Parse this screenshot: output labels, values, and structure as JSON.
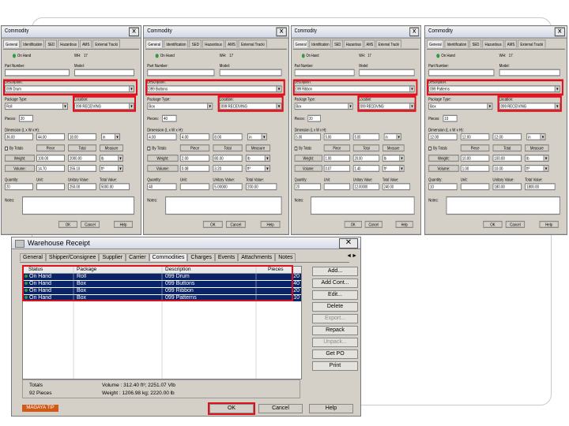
{
  "dialogs": [
    {
      "title": "Commodity",
      "tabs": [
        "General",
        "Identification",
        "SED",
        "Hazardous",
        "AMS",
        "External Tracki"
      ],
      "status": "On Hand",
      "wh_label": "WH:",
      "wh_value": "17",
      "part_label": "Part Number:",
      "model_label": "Model:",
      "desc_label": "Description:",
      "desc_value": "099 Drum",
      "pkg_label": "Package Type:",
      "pkg_value": "Roll",
      "loc_label": "Location:",
      "loc_value": "099 RECEIVING",
      "pieces_label": "Pieces:",
      "pieces_value": "20",
      "dim_label": "Dimension (L x W x H):",
      "dim_values": [
        "36.00",
        "44.00",
        "18.00",
        "in"
      ],
      "bytotals_label": "By Totals",
      "col_piece": "Piece",
      "col_total": "Total",
      "col_measure": "Measure",
      "weight_label": "Weight:",
      "weight_values": [
        "100.00",
        "2000.00",
        "lb"
      ],
      "volume_label": "Volume:",
      "volume_values": [
        "14.70",
        "255.10",
        "ft³"
      ],
      "qty_label": "Quantity:",
      "unit_label": "Unit:",
      "uv_label": "Unitary Value:",
      "tv_label": "Total Value:",
      "qty_value": "20",
      "unit_value": "",
      "uv_value": "250.00",
      "tv_value": "5000.00",
      "notes_label": "Notes:",
      "ok": "OK",
      "cancel": "Cancel",
      "help": "Help"
    },
    {
      "title": "Commodity",
      "tabs": [
        "General",
        "Identification",
        "SED",
        "Hazardous",
        "AMS",
        "External Tracki"
      ],
      "status": "On Hand",
      "wh_label": "WH:",
      "wh_value": "17",
      "part_label": "Part Number:",
      "model_label": "Model:",
      "desc_label": "Description:",
      "desc_value": "099 Buttons",
      "pkg_label": "Package Type:",
      "pkg_value": "Box",
      "loc_label": "Location:",
      "loc_value": "099 RECEIVING",
      "pieces_label": "Pieces:",
      "pieces_value": "40",
      "dim_label": "Dimension (L x W x H):",
      "dim_values": [
        "4.00",
        "4.00",
        "8.00",
        "in"
      ],
      "bytotals_label": "By Totals",
      "col_piece": "Piece",
      "col_total": "Total",
      "col_measure": "Measure",
      "weight_label": "Weight:",
      "weight_values": [
        "2.00",
        "80.00",
        "lb"
      ],
      "volume_label": "Volume:",
      "volume_values": [
        "0.08",
        "3.20",
        "ft³"
      ],
      "qty_label": "Quantity:",
      "unit_label": "Unit:",
      "uv_label": "Unitary Value:",
      "tv_label": "Total Value:",
      "qty_value": "40",
      "unit_value": "",
      "uv_value": "5.00000",
      "tv_value": "200.00",
      "notes_label": "Notes:",
      "ok": "OK",
      "cancel": "Cancel",
      "help": "Help"
    },
    {
      "title": "Commodity",
      "tabs": [
        "General",
        "Identification",
        "SED",
        "Hazardous",
        "AMS",
        "External Tracki"
      ],
      "status": "On Hand",
      "wh_label": "WH:",
      "wh_value": "17",
      "part_label": "Part Number:",
      "model_label": "Model:",
      "desc_label": "Description:",
      "desc_value": "099 Ribbon",
      "pkg_label": "Package Type:",
      "pkg_value": "Box",
      "loc_label": "Location:",
      "loc_value": "099 RECEIVING",
      "pieces_label": "Pieces:",
      "pieces_value": "20",
      "dim_label": "Dimension (L x W x H):",
      "dim_values": [
        "5.00",
        "5.00",
        "5.00",
        "in"
      ],
      "bytotals_label": "By Totals",
      "col_piece": "Piece",
      "col_total": "Total",
      "col_measure": "Measure",
      "weight_label": "Weight:",
      "weight_values": [
        "1.00",
        "20.00",
        "lb"
      ],
      "volume_label": "Volume:",
      "volume_values": [
        "0.07",
        "1.40",
        "ft³"
      ],
      "qty_label": "Quantity:",
      "unit_label": "Unit:",
      "uv_label": "Unitary Value:",
      "tv_label": "Total Value:",
      "qty_value": "20",
      "unit_value": "",
      "uv_value": "12.00000",
      "tv_value": "240.00",
      "notes_label": "Notes:",
      "ok": "OK",
      "cancel": "Cancel",
      "help": "Help"
    },
    {
      "title": "Commodity",
      "tabs": [
        "General",
        "Identification",
        "SED",
        "Hazardous",
        "AMS",
        "External Tracki"
      ],
      "status": "On Hand",
      "wh_label": "WH:",
      "wh_value": "17",
      "part_label": "Part Number:",
      "model_label": "Model:",
      "desc_label": "Description:",
      "desc_value": "099 Patterns",
      "pkg_label": "Package Type:",
      "pkg_value": "Box",
      "loc_label": "Location:",
      "loc_value": "099 RECEIVING",
      "pieces_label": "Pieces:",
      "pieces_value": "10",
      "dim_label": "Dimension (L x W x H):",
      "dim_values": [
        "12.00",
        "12.00",
        "12.00",
        "in"
      ],
      "bytotals_label": "By Totals",
      "col_piece": "Piece",
      "col_total": "Total",
      "col_measure": "Measure",
      "weight_label": "Weight:",
      "weight_values": [
        "10.00",
        "100.00",
        "lb"
      ],
      "volume_label": "Volume:",
      "volume_values": [
        "1.00",
        "10.00",
        "ft³"
      ],
      "qty_label": "Quantity:",
      "unit_label": "Unit:",
      "uv_label": "Unitary Value:",
      "tv_label": "Total Value:",
      "qty_value": "10",
      "unit_value": "",
      "uv_value": "180.00",
      "tv_value": "1800.00",
      "notes_label": "Notes:",
      "ok": "OK",
      "cancel": "Cancel",
      "help": "Help"
    }
  ],
  "receipt": {
    "title": "Warehouse Receipt",
    "tabs": [
      "General",
      "Shipper/Consignee",
      "Supplier",
      "Carrier",
      "Commodities",
      "Charges",
      "Events",
      "Attachments",
      "Notes"
    ],
    "columns": [
      "Status",
      "Package",
      "Description",
      "Pieces"
    ],
    "rows": [
      {
        "status": "On Hand",
        "package": "Roll",
        "description": "099 Drum",
        "pieces": "20"
      },
      {
        "status": "On Hand",
        "package": "Box",
        "description": "099 Buttons",
        "pieces": "40"
      },
      {
        "status": "On Hand",
        "package": "Box",
        "description": "099 Ribbon",
        "pieces": "20"
      },
      {
        "status": "On Hand",
        "package": "Box",
        "description": "099 Patterns",
        "pieces": "10"
      }
    ],
    "side_buttons": {
      "add": "Add...",
      "add_cont": "Add Cont...",
      "edit": "Edit...",
      "delete": "Delete",
      "export": "Export...",
      "repack": "Repack",
      "unpack": "Unpack...",
      "get_po": "Get PO",
      "print": "Print"
    },
    "totals_label": "Totals",
    "pieces_total": "92 Pieces",
    "volume_total": "Volume : 312.40 ft³; 2251.07 Vlb",
    "weight_total": "Weight : 1206.98 kg; 2220.00 lb",
    "brand": "MAGAYA TIP",
    "ok": "OK",
    "cancel": "Cancel",
    "help": "Help"
  }
}
